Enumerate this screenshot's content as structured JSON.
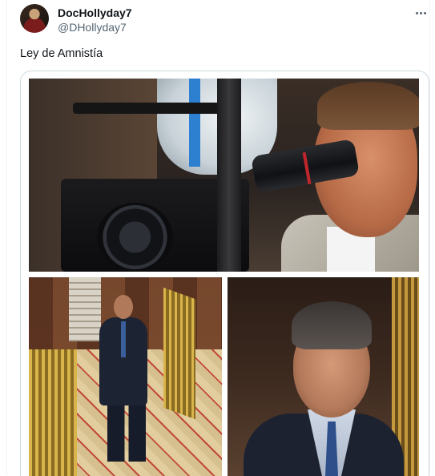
{
  "author": {
    "display_name": "DocHollyday7",
    "handle": "@DHollyday7",
    "avatar_icon": "profile-avatar"
  },
  "menu": {
    "icon": "more-horizontal-icon"
  },
  "tweet": {
    "text": "Ley de Amnistía"
  },
  "media": {
    "photos": [
      {
        "name": "photo-camera-actor",
        "description_icon": "image-icon"
      },
      {
        "name": "photo-parliament-walk",
        "description_icon": "image-icon"
      },
      {
        "name": "photo-face-closeup",
        "description_icon": "image-icon"
      }
    ]
  },
  "colors": {
    "text_primary": "#0f1419",
    "text_secondary": "#536471",
    "border": "#cfd9de"
  }
}
